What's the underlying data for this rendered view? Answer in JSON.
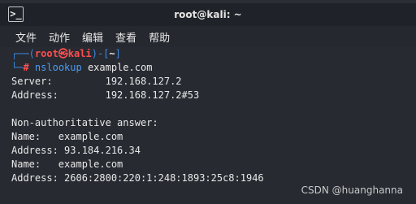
{
  "window": {
    "title": "root@kali: ~",
    "icon": "terminal-icon",
    "icon_glyph": ">_"
  },
  "menu": [
    "文件",
    "动作",
    "编辑",
    "查看",
    "帮助"
  ],
  "prompt": {
    "corner_top": "┌──(",
    "user": "root㉿kali",
    "mid": ")-[",
    "path": "~",
    "close": "]",
    "corner_bottom": "└─",
    "symbol": "#",
    "command": "nslookup",
    "argument": "example.com"
  },
  "output": [
    "Server:         192.168.127.2",
    "Address:        192.168.127.2#53",
    "",
    "Non-authoritative answer:",
    "Name:   example.com",
    "Address: 93.184.216.34",
    "Name:   example.com",
    "Address: 2606:2800:220:1:248:1893:25c8:1946"
  ],
  "watermark": "CSDN @huanghanna",
  "colors": {
    "prompt_frame": "#3e88e0",
    "user_host": "#ff4e4e",
    "command": "#4c9cf4",
    "text": "#e8e8e8",
    "background": "#272a31"
  }
}
